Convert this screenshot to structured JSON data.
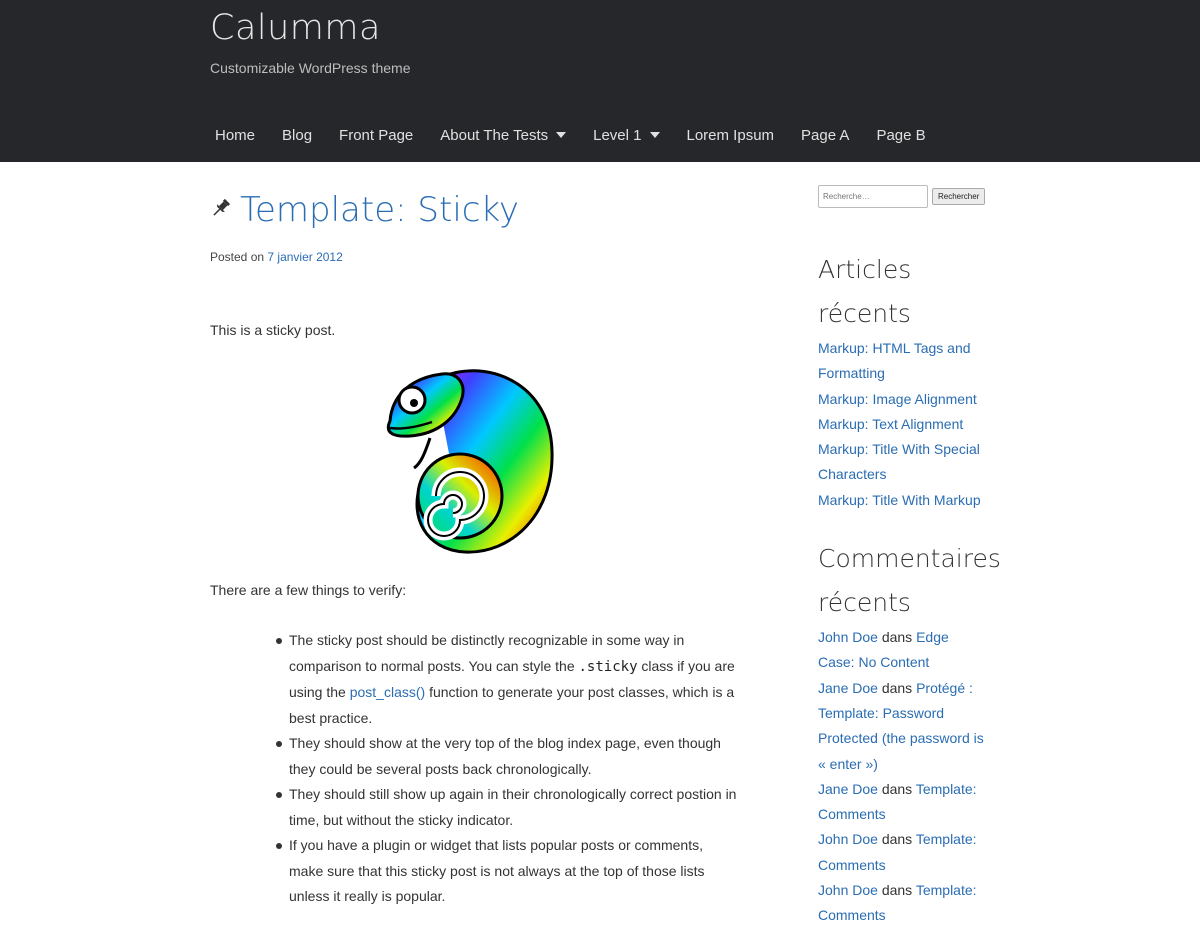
{
  "header": {
    "site_title": "Calumma",
    "site_description": "Customizable WordPress theme",
    "nav": [
      {
        "label": "Home",
        "dropdown": false
      },
      {
        "label": "Blog",
        "dropdown": false
      },
      {
        "label": "Front Page",
        "dropdown": false
      },
      {
        "label": "About The Tests",
        "dropdown": true
      },
      {
        "label": "Level 1",
        "dropdown": true
      },
      {
        "label": "Lorem Ipsum",
        "dropdown": false
      },
      {
        "label": "Page A",
        "dropdown": false
      },
      {
        "label": "Page B",
        "dropdown": false
      }
    ]
  },
  "post": {
    "icon": "pin-icon",
    "title": "Template: Sticky",
    "meta_prefix": "Posted on",
    "date": "7 janvier 2012",
    "intro": "This is a sticky post.",
    "image": "chameleon-illustration",
    "verify_intro": "There are a few things to verify:",
    "bullet1_a": "The sticky post should be distinctly recognizable in some way in comparison to normal posts. You can style the",
    "bullet1_code": ".sticky",
    "bullet1_b": "class if you are using the",
    "bullet1_link": "post_class()",
    "bullet1_c": "function to generate your post classes, which is a best practice.",
    "bullet2": "They should show at the very top of the blog index page, even though they could be several posts back chronologically.",
    "bullet3": "They should still show up again in their chronologically correct postion in time, but without the sticky indicator.",
    "bullet4": "If you have a plugin or widget that lists popular posts or comments, make sure that this sticky post is not always at the top of those lists unless it really is popular."
  },
  "sidebar": {
    "search_placeholder": "Recherche…",
    "search_button": "Rechercher",
    "recent_title": "Articles récents",
    "recent_posts": [
      "Markup: HTML Tags and Formatting",
      "Markup: Image Alignment",
      "Markup: Text Alignment",
      "Markup: Title With Special Characters",
      "Markup: Title With Markup"
    ],
    "comments_title": "Commentaires récents",
    "comments": [
      {
        "author": "John Doe",
        "sep": "dans",
        "post": "Edge Case: No Content"
      },
      {
        "author": "Jane Doe",
        "sep": "dans",
        "post": "Protégé : Template: Password Protected (the password is « enter »)"
      },
      {
        "author": "Jane Doe",
        "sep": "dans",
        "post": "Template: Comments"
      },
      {
        "author": "John Doe",
        "sep": "dans",
        "post": "Template: Comments"
      },
      {
        "author": "John Doe",
        "sep": "dans",
        "post": "Template: Comments"
      }
    ]
  },
  "colors": {
    "header_bg": "#25272a",
    "link": "#2a6db3"
  }
}
